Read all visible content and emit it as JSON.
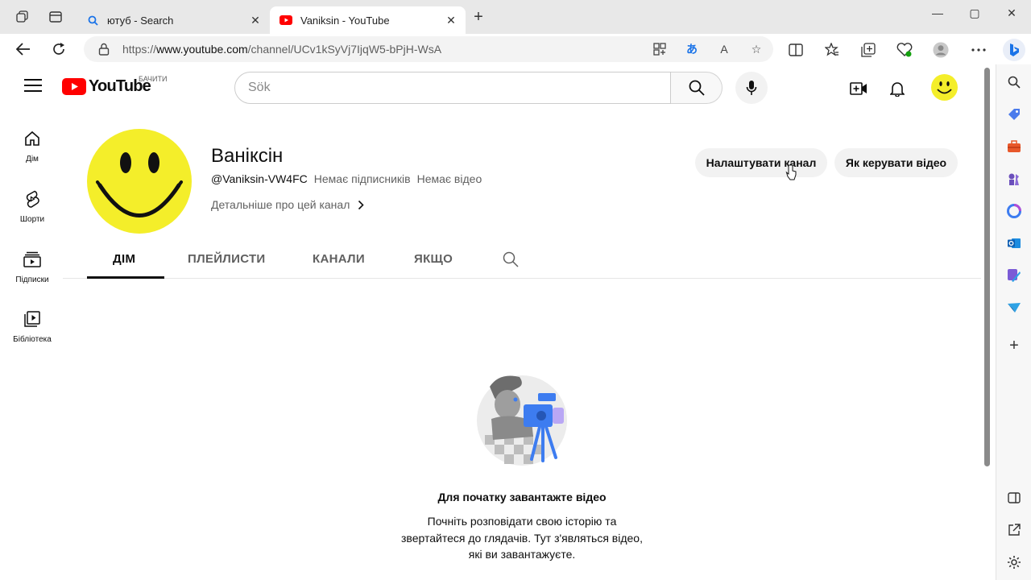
{
  "browser": {
    "tabs": [
      {
        "title": "ютуб - Search",
        "favicon": "search-icon",
        "active": false
      },
      {
        "title": "Vaniksin - YouTube",
        "favicon": "youtube-icon",
        "active": true
      }
    ],
    "url_prefix": "https://",
    "url_domain": "www.youtube.com",
    "url_path": "/channel/UCv1kSyVj7IjqW5-bPjH-WsA"
  },
  "header": {
    "logo_text": "YouTube",
    "country_code": "БАЧИТИ",
    "search_placeholder": "Sök"
  },
  "guide": {
    "items": [
      {
        "label": "Дім",
        "icon": "home-icon"
      },
      {
        "label": "Шорти",
        "icon": "shorts-icon"
      },
      {
        "label": "Підписки",
        "icon": "subscriptions-icon"
      },
      {
        "label": "Бібліотека",
        "icon": "library-icon"
      }
    ]
  },
  "channel": {
    "name": "Ваніксін",
    "handle": "@Vaniksin-VW4FC",
    "subscribers": "Немає підписників",
    "videos": "Немає відео",
    "more_link": "Детальніше про цей канал",
    "customize_button": "Налаштувати канал",
    "manage_videos_button": "Як керувати відео",
    "tabs": [
      "ДІМ",
      "ПЛЕЙЛИСТИ",
      "КАНАЛИ",
      "ЯКЩО"
    ]
  },
  "empty_state": {
    "title": "Для початку завантажте відео",
    "line1": "Почніть розповідати свою історію та",
    "line2": "звертайтеся до глядачів. Тут з'являться відео,",
    "line3": "які ви завантажуєте."
  },
  "colors": {
    "youtube_red": "#ff0000",
    "smiley_yellow": "#f4ee2a",
    "illustration_blue": "#3d7cf0"
  }
}
